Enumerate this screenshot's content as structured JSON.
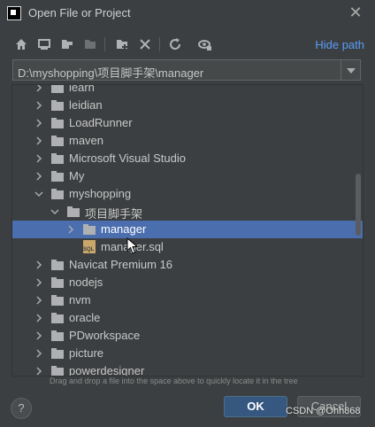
{
  "window": {
    "title": "Open File or Project",
    "close_icon": "close-icon"
  },
  "toolbar": {
    "icons": [
      "home-icon",
      "desktop-icon",
      "project-folder-icon",
      "module-folder-icon",
      "new-folder-icon",
      "delete-icon",
      "refresh-icon",
      "show-hidden-icon"
    ],
    "hide_path_label": "Hide path"
  },
  "path": {
    "value": "D:\\myshopping\\项目脚手架\\manager"
  },
  "tree": {
    "items": [
      {
        "label": "learn",
        "type": "folder",
        "expanded": false
      },
      {
        "label": "leidian",
        "type": "folder",
        "expanded": false
      },
      {
        "label": "LoadRunner",
        "type": "folder",
        "expanded": false
      },
      {
        "label": "maven",
        "type": "folder",
        "expanded": false
      },
      {
        "label": "Microsoft Visual Studio",
        "type": "folder",
        "expanded": false
      },
      {
        "label": "My",
        "type": "folder",
        "expanded": false
      },
      {
        "label": "myshopping",
        "type": "folder",
        "expanded": true
      },
      {
        "label": "项目脚手架",
        "type": "folder",
        "expanded": true
      },
      {
        "label": "manager",
        "type": "folder",
        "expanded": false,
        "selected": true
      },
      {
        "label": "manager.sql",
        "type": "sql-file"
      },
      {
        "label": "Navicat Premium 16",
        "type": "folder",
        "expanded": false
      },
      {
        "label": "nodejs",
        "type": "folder",
        "expanded": false
      },
      {
        "label": "nvm",
        "type": "folder",
        "expanded": false
      },
      {
        "label": "oracle",
        "type": "folder",
        "expanded": false
      },
      {
        "label": "PDworkspace",
        "type": "folder",
        "expanded": false
      },
      {
        "label": "picture",
        "type": "folder",
        "expanded": false
      },
      {
        "label": "powerdesigner",
        "type": "folder",
        "expanded": false
      }
    ]
  },
  "hint": "Drag and drop a file into the space above to quickly locate it in the tree",
  "buttons": {
    "help": "?",
    "ok": "OK",
    "cancel": "Cancel"
  },
  "watermark": "CSDN @Ohh868",
  "colors": {
    "background": "#3c3f41",
    "selection": "#4b6eaf",
    "link": "#589df6",
    "ok_button": "#365880"
  }
}
